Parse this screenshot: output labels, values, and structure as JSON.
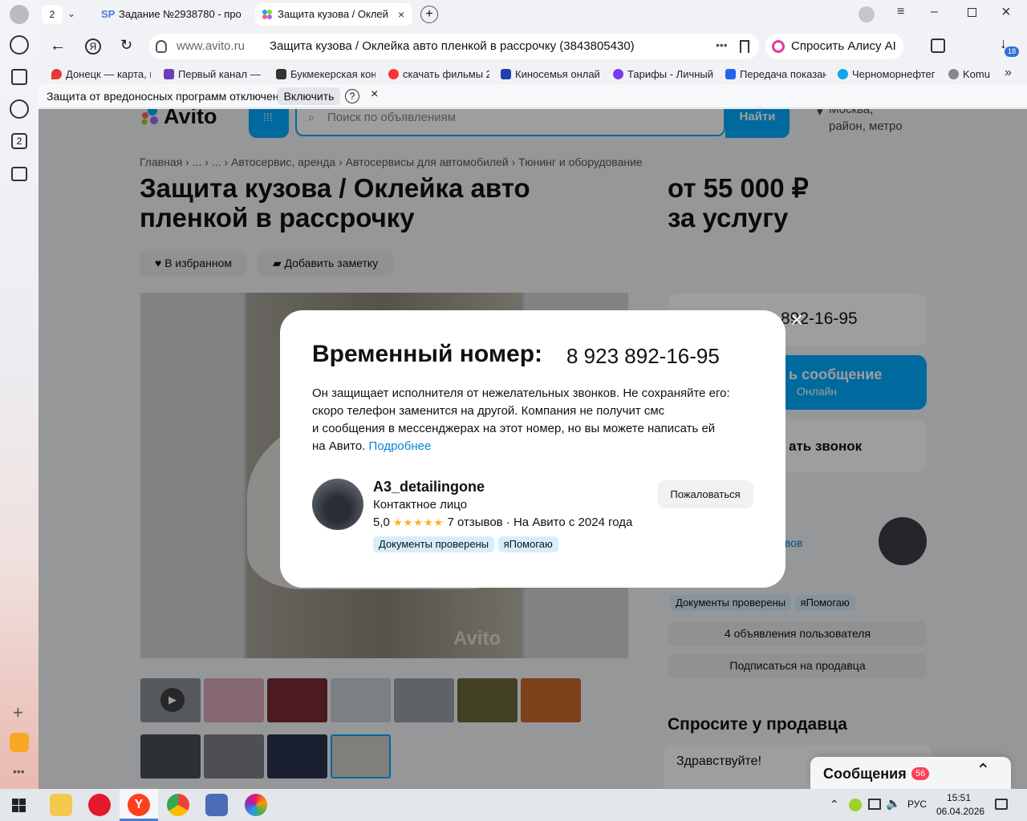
{
  "browser": {
    "tab_counter": "2",
    "tabs": [
      {
        "label": "Задание №2938780 - про",
        "icon_text": "SP"
      },
      {
        "label": "Защита кузова / Оклей"
      }
    ],
    "address_domain": "www.avito.ru",
    "address_title": "Защита кузова / Оклейка авто пленкой в рассрочку (3843805430)",
    "alice_button": "Спросить Алису AI",
    "downloads_badge": "18",
    "bookmarks": [
      {
        "label": "Донецк — карта, г",
        "color": "#e53935"
      },
      {
        "label": "Первый канал — с",
        "color": "#6a3fb5"
      },
      {
        "label": "Букмекерская кон",
        "color": "#333333"
      },
      {
        "label": "скачать фильмы 2",
        "color": "#f33"
      },
      {
        "label": "Киносемья онлай",
        "color": "#1e40af"
      },
      {
        "label": "Тарифы - Личный",
        "color": "#7c3aed"
      },
      {
        "label": "Передача показан",
        "color": "#2563eb"
      },
      {
        "label": "Черноморнефтег",
        "color": "#0ea5e9"
      },
      {
        "label": "Komu",
        "color": "#888888"
      }
    ],
    "infobar_text": "Защита от вредоносных программ отключена",
    "infobar_button": "Включить",
    "infobar_help": "?",
    "infobar_close": "×"
  },
  "avito": {
    "logo": "Avito",
    "search_placeholder": "Поиск по объявлениям",
    "search_button": "Найти",
    "location_line1": "Москва,",
    "location_line2": "район, метро",
    "breadcrumbs": [
      "Главная",
      "...",
      "...",
      "Автосервис, аренда",
      "Автосервисы для автомобилей",
      "Тюнинг и оборудование"
    ],
    "title_line1": "Защита кузова / Оклейка авто",
    "title_line2": "пленкой в рассрочку",
    "price_line1": "от 55 000 ₽",
    "price_line2": "за услугу",
    "favorite_button": "В избранном",
    "note_button": "Добавить заметку",
    "phone_partial": "892-16-95",
    "message_partial": "ь сообщение",
    "message_sub_partial": "Онлайн",
    "call_partial": "ать звонок",
    "reviews_partial": "вов",
    "seller_chips": [
      "Документы проверены",
      "яПомогаю"
    ],
    "ads_button": "4 объявления пользователя",
    "subscribe_button": "Подписаться на продавца",
    "ask_title": "Спросите у продавца",
    "ask_input": "Здравствуйте!",
    "messages_label": "Сообщения",
    "messages_badge": "56",
    "watermark": "Avito"
  },
  "modal": {
    "title": "Временный номер:",
    "phone": "8 923 892-16-95",
    "desc_line1": "Он защищает исполнителя от нежелательных звонков. Не сохраняйте его:",
    "desc_line2": "скоро телефон заменится на другой. Компания не получит смс",
    "desc_line3": "и сообщения в мессенджерах на этот номер, но вы можете написать ей",
    "desc_line4": "на Авито.",
    "more_link": "Подробнее",
    "seller_name": "A3_detailingone",
    "seller_role": "Контактное лицо",
    "rating": "5,0",
    "stars": "★★★★★",
    "reviews": "7 отзывов · На Авито с 2024 года",
    "chips": [
      "Документы проверены",
      "яПомогаю"
    ],
    "report_button": "Пожаловаться",
    "close": "×"
  },
  "taskbar": {
    "lang": "РУС",
    "time": "15:51",
    "date": "06.04.2026"
  }
}
